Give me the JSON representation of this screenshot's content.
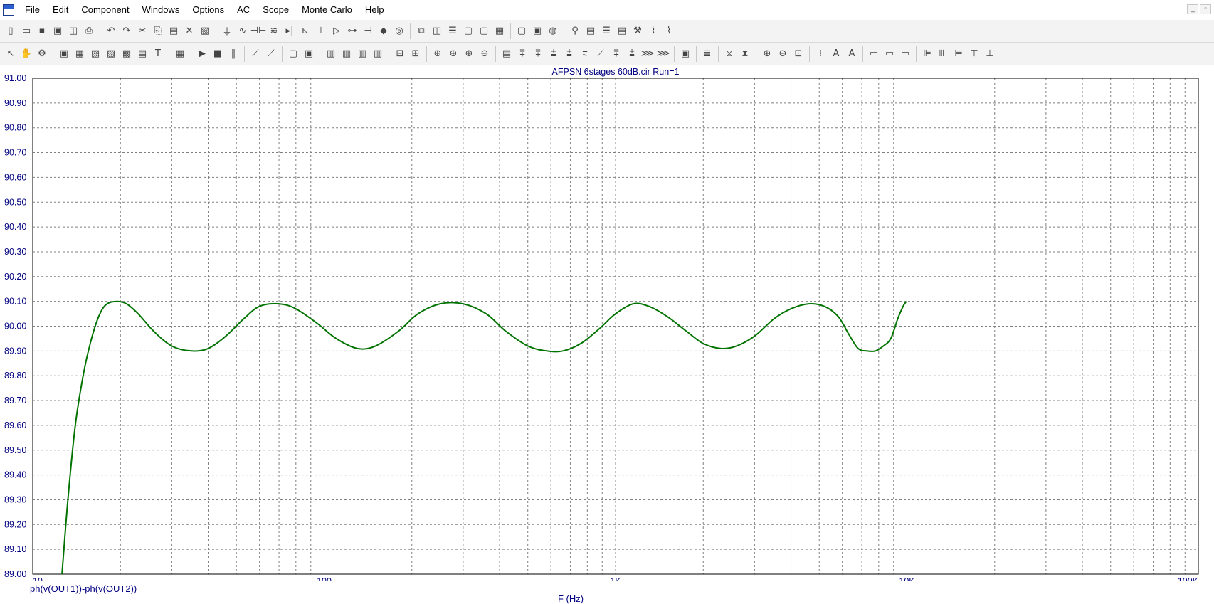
{
  "menu": [
    "File",
    "Edit",
    "Component",
    "Windows",
    "Options",
    "AC",
    "Scope",
    "Monte Carlo",
    "Help"
  ],
  "window_controls": [
    "_",
    "▫"
  ],
  "toolbar1_icons": [
    "new-file-icon",
    "open-file-icon",
    "save-icon",
    "print-preview-icon",
    "find-icon",
    "print-icon",
    "|",
    "undo-icon",
    "redo-icon",
    "cut-icon",
    "copy-icon",
    "paste-icon",
    "delete-icon",
    "clear-icon",
    "|",
    "ground-icon",
    "resistor-icon",
    "capacitor-icon",
    "inductor-icon",
    "diode-icon",
    "transistor-icon",
    "battery-icon",
    "opamp-icon",
    "switch-icon",
    "capacitor2-icon",
    "node-icon",
    "source-icon",
    "|",
    "window-cascade-icon",
    "tile-vertical-icon",
    "tile-horizontal-icon",
    "window-icon",
    "window2-icon",
    "calculator-icon",
    "|",
    "component-icon",
    "library-icon",
    "globe-icon",
    "|",
    "probe-icon",
    "properties-icon",
    "list-icon",
    "netlist-icon",
    "tools-icon",
    "analysis-icon",
    "analysis2-icon"
  ],
  "toolbar1_glyphs": [
    "▯",
    "▭",
    "▪",
    "▣",
    "◫",
    "⎙",
    "",
    "↶",
    "↷",
    "✂",
    "⎘",
    "▤",
    "✕",
    "▧",
    "",
    "⏚",
    "∿",
    "⊣⊢",
    "≋",
    "▸|",
    "⊾",
    "⊥",
    "▷",
    "⊶",
    "⊣",
    "◆",
    "◎",
    "",
    "⧉",
    "◫",
    "☰",
    "▢",
    "▢",
    "▦",
    "",
    "▢",
    "▣",
    "◍",
    "",
    "⚲",
    "▤",
    "☰",
    "▤",
    "⚒",
    "⌇",
    "⌇"
  ],
  "toolbar2_icons": [
    "select-icon",
    "pan-icon",
    "component-mode-icon",
    "|",
    "img-icon",
    "img2-icon",
    "graph-icon",
    "graph2-icon",
    "graph3-icon",
    "graph4-icon",
    "text-icon",
    "|",
    "props-icon",
    "|",
    "run-icon",
    "stop-icon",
    "pause-icon",
    "|",
    "trace-icon",
    "trace2-icon",
    "|",
    "box-icon",
    "box2-icon",
    "|",
    "tile1-icon",
    "tile2-icon",
    "tile3-icon",
    "tile4-icon",
    "|",
    "split-h-icon",
    "split-v-icon",
    "|",
    "zoom-fit-icon",
    "zoom-fit2-icon",
    "zoom-fit3-icon",
    "zoom-fit4-icon",
    "|",
    "cursor-icon",
    "peak-icon",
    "valley-icon",
    "high-icon",
    "low-icon",
    "inflection-icon",
    "slope-icon",
    "global-high-icon",
    "global-low-icon",
    "top-icon",
    "bottom-icon",
    "|",
    "data-icon",
    "|",
    "list2-icon",
    "|",
    "scale-icon",
    "scale2-icon",
    "|",
    "zoom-in-icon",
    "zoom-out-icon",
    "zoom-box-icon",
    "|",
    "grid-icon",
    "font-icon",
    "color-icon",
    "|",
    "tool1-icon",
    "tool2-icon",
    "tool3-icon",
    "|",
    "align-left-icon",
    "align-center-icon",
    "align-right-icon",
    "align-top-icon",
    "align-middle-icon"
  ],
  "toolbar2_glyphs": [
    "↖",
    "✋",
    "⚙",
    "",
    "▣",
    "▦",
    "▧",
    "▨",
    "▩",
    "▤",
    "T",
    "",
    "▦",
    "",
    "▶",
    "■",
    "‖",
    "",
    "⟋",
    "⟋",
    "",
    "▢",
    "▣",
    "",
    "▥",
    "▥",
    "▥",
    "▥",
    "",
    "⊟",
    "⊞",
    "",
    "⊕",
    "⊕",
    "⊕",
    "⊖",
    "",
    "▤",
    "⩱",
    "⩱",
    "⩲",
    "⩲",
    "⩳",
    "⟋",
    "⩱",
    "⩲",
    "⋙",
    "⋙",
    "",
    "▣",
    "",
    "≣",
    "",
    "⧖",
    "⧗",
    "",
    "⊕",
    "⊖",
    "⊡",
    "",
    "⁞",
    "A",
    "A",
    "",
    "▭",
    "▭",
    "▭",
    "",
    "⊫",
    "⊪",
    "⊨",
    "⊤",
    "⊥"
  ],
  "chart": {
    "title": "AFPSN 6stages 60dB.cir Run=1",
    "legend": "ph(v(OUT1))-ph(v(OUT2))",
    "xlabel": "F (Hz)",
    "background": "#ffffff",
    "grid_color": "#808080",
    "trace_color": "#007300",
    "label_color": "#000080"
  },
  "chart_data": {
    "type": "line",
    "title": "AFPSN 6stages 60dB.cir Run=1",
    "xlabel": "F (Hz)",
    "ylabel": "",
    "xscale": "log",
    "xlim": [
      10,
      100000
    ],
    "ylim": [
      89.0,
      91.0
    ],
    "x_tick_labels": [
      "10",
      "100",
      "1K",
      "10K",
      "100K"
    ],
    "y_tick_labels": [
      "91.00",
      "90.90",
      "90.80",
      "90.70",
      "90.60",
      "90.50",
      "90.40",
      "90.30",
      "90.20",
      "90.10",
      "90.00",
      "89.90",
      "89.80",
      "89.70",
      "89.60",
      "89.50",
      "89.40",
      "89.30",
      "89.20",
      "89.10",
      "89.00"
    ],
    "grid": true,
    "series": [
      {
        "name": "ph(v(OUT1))-ph(v(OUT2))",
        "x": [
          12.6,
          13.2,
          14,
          15,
          16,
          17,
          18,
          19.5,
          21,
          23,
          26,
          30,
          35,
          40,
          46,
          53,
          60,
          70,
          80,
          95,
          110,
          130,
          150,
          180,
          210,
          250,
          300,
          360,
          420,
          500,
          580,
          660,
          760,
          880,
          1000,
          1150,
          1300,
          1500,
          1750,
          2000,
          2300,
          2600,
          3000,
          3500,
          4000,
          4600,
          5200,
          5800,
          6300,
          6800,
          7300,
          7800,
          8300,
          8800,
          9300,
          9700,
          9950
        ],
        "y": [
          89.0,
          89.3,
          89.6,
          89.82,
          89.96,
          90.05,
          90.09,
          90.1,
          90.09,
          90.05,
          89.98,
          89.92,
          89.9,
          89.91,
          89.96,
          90.03,
          90.08,
          90.09,
          90.07,
          90.01,
          89.95,
          89.91,
          89.92,
          89.98,
          90.05,
          90.09,
          90.09,
          90.05,
          89.98,
          89.92,
          89.9,
          89.9,
          89.93,
          89.99,
          90.05,
          90.09,
          90.08,
          90.04,
          89.98,
          89.93,
          89.91,
          89.92,
          89.96,
          90.03,
          90.07,
          90.09,
          90.08,
          90.04,
          89.97,
          89.91,
          89.9,
          89.9,
          89.92,
          89.95,
          90.03,
          90.08,
          90.1
        ]
      }
    ]
  }
}
